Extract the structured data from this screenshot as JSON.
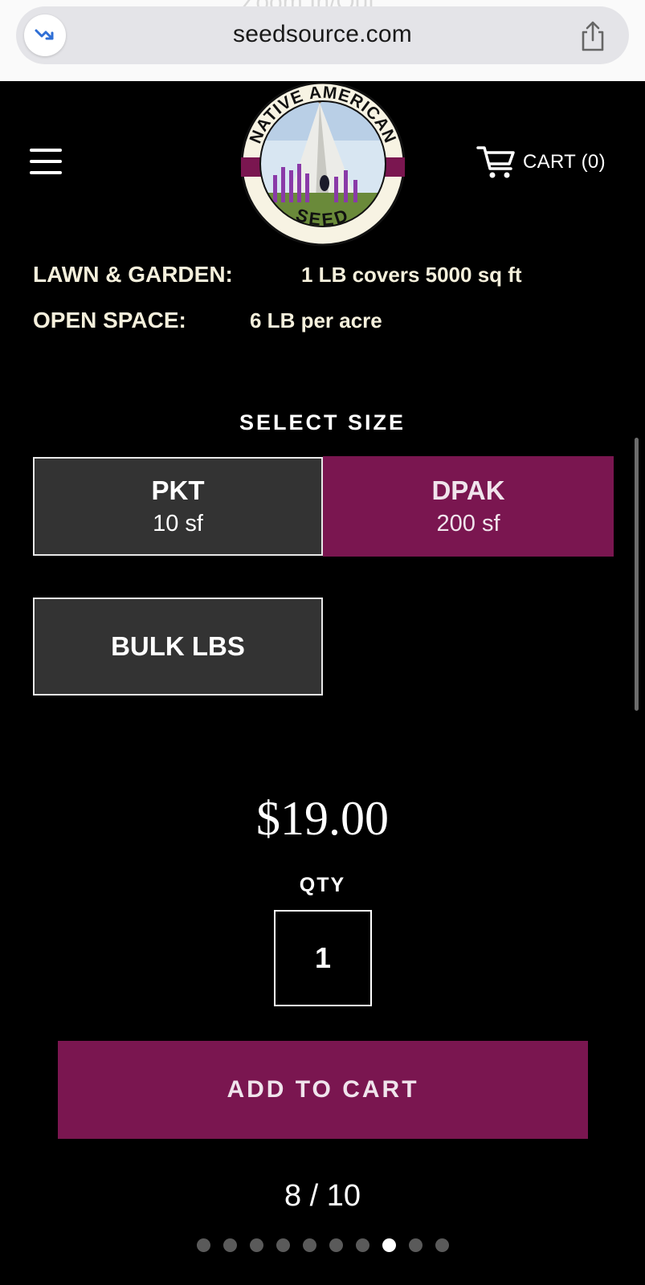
{
  "browser": {
    "ghost_overlay": "Zoom In/Out",
    "url": "seedsource.com"
  },
  "header": {
    "logo": {
      "top_text": "NATIVE AMERICAN",
      "bottom_text": "SEED"
    },
    "cart_label": "CART (0)"
  },
  "coverage": {
    "lawn_label": "LAWN & GARDEN:",
    "lawn_value": "1 LB covers 5000 sq ft",
    "open_label": "OPEN SPACE:",
    "open_value": "6 LB per acre"
  },
  "size_selector": {
    "title": "SELECT SIZE",
    "options": [
      {
        "name": "PKT",
        "area": "10 sf",
        "selected": false
      },
      {
        "name": "DPAK",
        "area": "200 sf",
        "selected": true
      },
      {
        "name": "BULK LBS",
        "area": "",
        "selected": false
      }
    ]
  },
  "purchase": {
    "price": "$19.00",
    "qty_label": "QTY",
    "qty_value": "1",
    "add_to_cart": "ADD TO CART"
  },
  "pager": {
    "count": "8 / 10",
    "total": 10,
    "active_index": 7
  },
  "colors": {
    "accent": "#7a1650",
    "button_dark": "#333333",
    "info_text": "#f5f0dc",
    "background": "#000000"
  }
}
